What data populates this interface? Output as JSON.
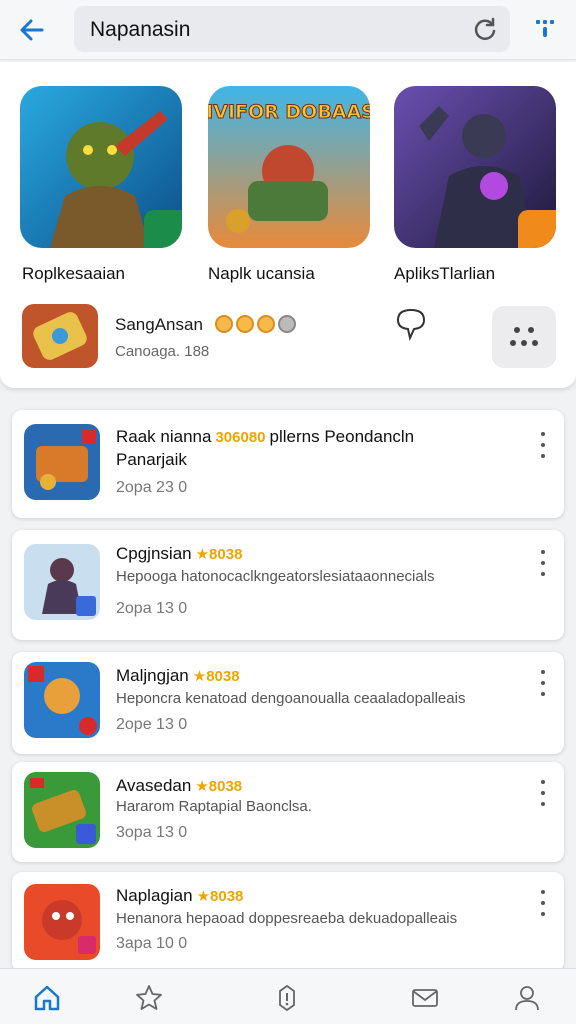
{
  "topbar": {
    "search_value": "Napanasin"
  },
  "featured": {
    "apps": [
      {
        "name": "Roplkesaaian"
      },
      {
        "name": "Naplk ucansia",
        "art_text": "NIVIFOR DOBAASS"
      },
      {
        "name": "ApliksTlarlian"
      }
    ],
    "spotlight": {
      "title": "SangAnsan",
      "subtitle": "Canoaga. 188"
    }
  },
  "list": [
    {
      "title": "Raak nianna",
      "rating": "306080",
      "extra": "pllerns Peondancln",
      "desc": "Panarjaik",
      "meta": "2opa 23  0"
    },
    {
      "title": "Cpgjnsian",
      "rating": "★8038",
      "desc": "Hepooga hatonocaclkngeatorslesiataaonnecials",
      "meta": "2opa 13  0"
    },
    {
      "title": "Maljngjan",
      "rating": "★8038",
      "desc": "Heponcra kenatoad dengoanoualla ceaaladopalleais",
      "meta": "2ope 13  0"
    },
    {
      "title": "Avasedan",
      "rating": "★8038",
      "desc": "Hararom Raptapial Baonclsa.",
      "meta": "3opa 13  0"
    },
    {
      "title": "Naplagian",
      "rating": "★8038",
      "desc": "Henanora hepaoad doppesreaeba dekuadopalleais",
      "meta": "3apa 10  0"
    }
  ],
  "colors": {
    "accent": "#1976d2",
    "star": "#f0a500"
  }
}
